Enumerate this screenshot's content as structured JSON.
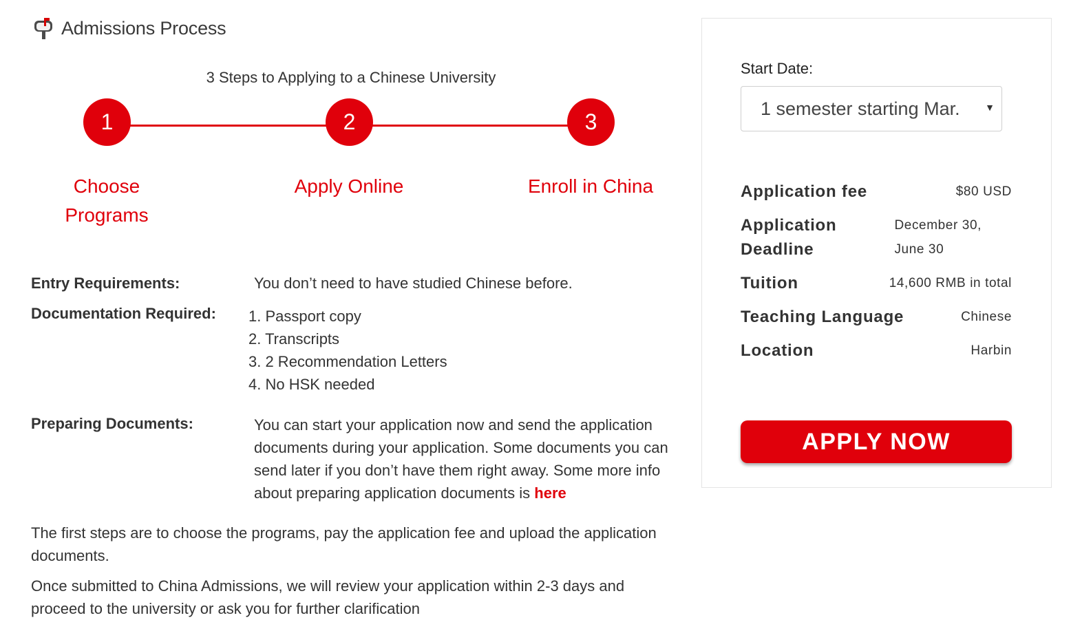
{
  "section": {
    "title": "Admissions Process",
    "icon": "mailbox-icon"
  },
  "steps": {
    "heading": "3 Steps to Applying to a Chinese University",
    "items": [
      {
        "number": "1",
        "label_line1": "Choose",
        "label_line2": "Programs"
      },
      {
        "number": "2",
        "label_line1": "Apply Online",
        "label_line2": ""
      },
      {
        "number": "3",
        "label_line1": "Enroll in China",
        "label_line2": ""
      }
    ]
  },
  "requirements": {
    "entry_label": "Entry Requirements:",
    "entry_value": "You don’t need to have studied Chinese before.",
    "documentation_label": "Documentation Required:",
    "documents": [
      "1. Passport copy",
      "2. Transcripts",
      "3. 2 Recommendation Letters",
      "4. No HSK needed"
    ],
    "preparing_label": "Preparing Documents:",
    "preparing_text": "You can start your application now and send the application documents during your application. Some documents you can send later if you don’t have them right away. Some more info about preparing application documents is ",
    "preparing_link": "here"
  },
  "paragraphs": {
    "first": "The first steps are to choose the programs, pay the application fee and upload the application documents.",
    "second": "Once submitted to China Admissions, we will review your application within 2-3 days and proceed to the university or ask you for further clarification"
  },
  "sidebar": {
    "start_date_label": "Start Date:",
    "start_date_selected": "1 semester starting Mar.",
    "application_fee_label": "Application fee",
    "application_fee_value": "$80 USD",
    "deadline_label_line1": "Application",
    "deadline_label_line2": "Deadline",
    "deadline_value_line1": "December 30,",
    "deadline_value_line2": "June 30",
    "tuition_label": "Tuition",
    "tuition_value": "14,600 RMB in total",
    "language_label": "Teaching Language",
    "language_value": "Chinese",
    "location_label": "Location",
    "location_value": "Harbin",
    "apply_button": "APPLY NOW"
  },
  "colors": {
    "accent": "#e0000b",
    "text": "#333333",
    "border": "#e4e4e4"
  }
}
